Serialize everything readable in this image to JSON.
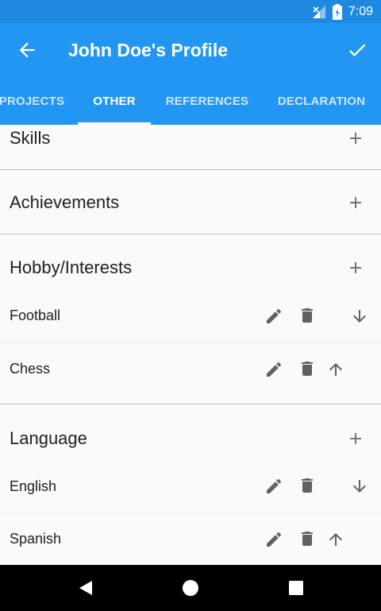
{
  "status_bar": {
    "time": "7:09"
  },
  "app_bar": {
    "title": "John Doe's Profile"
  },
  "tabs": [
    {
      "label": "PROJECTS",
      "active": false
    },
    {
      "label": "OTHER",
      "active": true
    },
    {
      "label": "REFERENCES",
      "active": false
    },
    {
      "label": "DECLARATION",
      "active": false
    }
  ],
  "sections": {
    "skills": {
      "title": "Skills"
    },
    "achievements": {
      "title": "Achievements"
    },
    "hobby": {
      "title": "Hobby/Interests",
      "items": [
        "Football",
        "Chess"
      ]
    },
    "language": {
      "title": "Language",
      "items": [
        "English",
        "Spanish"
      ]
    }
  },
  "icons": {
    "back": "arrow-left-icon",
    "save": "check-icon",
    "add": "plus-icon",
    "edit": "pencil-icon",
    "delete": "trash-icon",
    "move_down": "arrow-down-icon",
    "move_up": "arrow-up-icon"
  },
  "colors": {
    "primary": "#2196f3",
    "status_bar": "#1f89e0",
    "icon_gray": "#616161",
    "text": "#212121"
  }
}
